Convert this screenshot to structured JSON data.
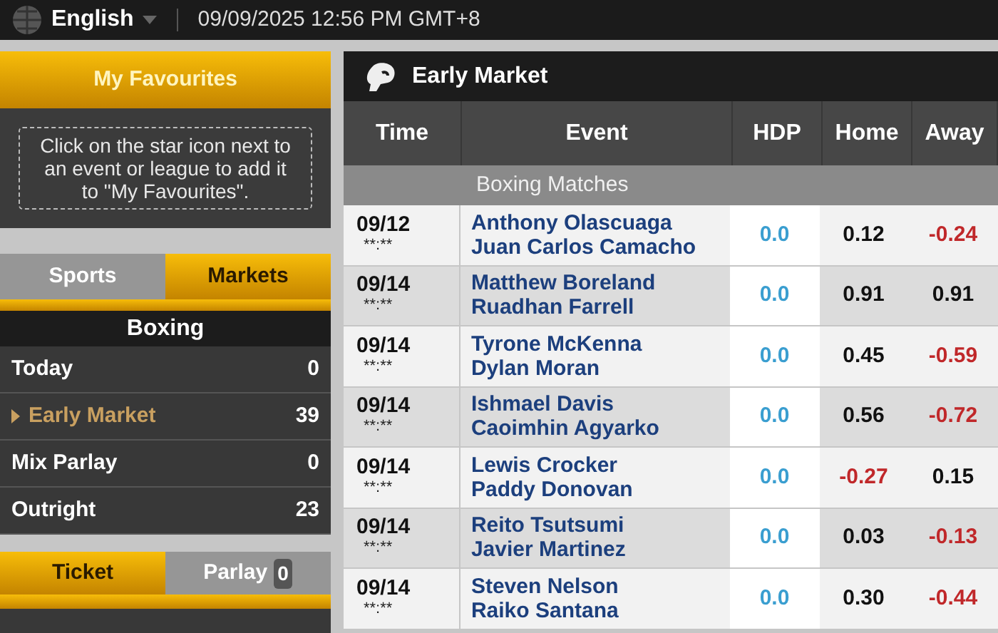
{
  "top_bar": {
    "language": "English",
    "datetime": "09/09/2025 12:56 PM GMT+8"
  },
  "favourites": {
    "title": "My Favourites",
    "hint": "Click on the star icon next to an event or league to add it to \"My Favourites\"."
  },
  "nav_tabs": [
    {
      "label": "Sports",
      "selected": false
    },
    {
      "label": "Markets",
      "selected": true
    }
  ],
  "sport": "Boxing",
  "markets": [
    {
      "label": "Today",
      "count": "0",
      "selected": false
    },
    {
      "label": "Early Market",
      "count": "39",
      "selected": true
    },
    {
      "label": "Mix Parlay",
      "count": "0",
      "selected": false
    },
    {
      "label": "Outright",
      "count": "23",
      "selected": false
    }
  ],
  "ticket_tabs": [
    {
      "label": "Ticket",
      "selected": true
    },
    {
      "label": "Parlay",
      "selected": false,
      "badge": "0"
    }
  ],
  "main": {
    "title": "Early Market",
    "columns": [
      "Time",
      "Event",
      "HDP",
      "Home",
      "Away"
    ],
    "group": "Boxing Matches",
    "rows": [
      {
        "date": "09/12",
        "time": "**:**",
        "home": "Anthony Olascuaga",
        "away": "Juan Carlos Camacho",
        "hdp": "0.0",
        "home_odds": {
          "value": "0.12",
          "negative": false
        },
        "away_odds": {
          "value": "-0.24",
          "negative": true
        }
      },
      {
        "date": "09/14",
        "time": "**:**",
        "home": "Matthew Boreland",
        "away": "Ruadhan Farrell",
        "hdp": "0.0",
        "home_odds": {
          "value": "0.91",
          "negative": false
        },
        "away_odds": {
          "value": "0.91",
          "negative": false
        }
      },
      {
        "date": "09/14",
        "time": "**:**",
        "home": "Tyrone McKenna",
        "away": "Dylan Moran",
        "hdp": "0.0",
        "home_odds": {
          "value": "0.45",
          "negative": false
        },
        "away_odds": {
          "value": "-0.59",
          "negative": true
        }
      },
      {
        "date": "09/14",
        "time": "**:**",
        "home": "Ishmael Davis",
        "away": "Caoimhin Agyarko",
        "hdp": "0.0",
        "home_odds": {
          "value": "0.56",
          "negative": false
        },
        "away_odds": {
          "value": "-0.72",
          "negative": true
        }
      },
      {
        "date": "09/14",
        "time": "**:**",
        "home": "Lewis Crocker",
        "away": "Paddy Donovan",
        "hdp": "0.0",
        "home_odds": {
          "value": "-0.27",
          "negative": true
        },
        "away_odds": {
          "value": "0.15",
          "negative": false
        }
      },
      {
        "date": "09/14",
        "time": "**:**",
        "home": "Reito Tsutsumi",
        "away": "Javier Martinez",
        "hdp": "0.0",
        "home_odds": {
          "value": "0.03",
          "negative": false
        },
        "away_odds": {
          "value": "-0.13",
          "negative": true
        }
      },
      {
        "date": "09/14",
        "time": "**:**",
        "home": "Steven Nelson",
        "away": "Raiko Santana",
        "hdp": "0.0",
        "home_odds": {
          "value": "0.30",
          "negative": false
        },
        "away_odds": {
          "value": "-0.44",
          "negative": true
        }
      }
    ]
  }
}
